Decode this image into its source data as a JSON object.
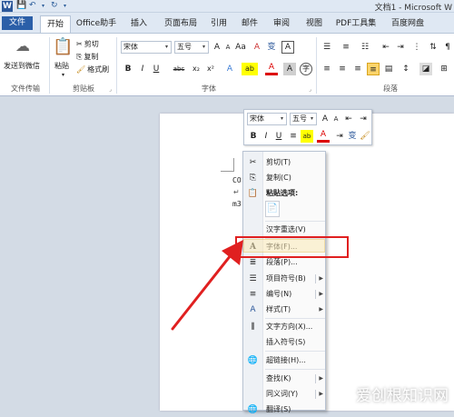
{
  "titlebar": {
    "app_icon": "W",
    "save_icon": "save-icon",
    "undo_icon": "undo-icon",
    "redo_icon": "redo-icon",
    "title": "文档1 - Microsoft W"
  },
  "tabs": [
    "文件",
    "开始",
    "Office助手",
    "插入",
    "页面布局",
    "引用",
    "邮件",
    "审阅",
    "视图",
    "PDF工具集",
    "百度网盘"
  ],
  "ribbon": {
    "wechat": {
      "label": "发送到微信",
      "group": "文件传输"
    },
    "clipboard": {
      "paste": "粘贴",
      "cut": "剪切",
      "copy": "复制",
      "format_painter": "格式刷",
      "group": "剪贴板"
    },
    "font": {
      "name": "宋体",
      "size": "五号",
      "group": "字体",
      "grow": "A",
      "shrink": "A",
      "aa": "Aa",
      "clear": "A",
      "wen": "变",
      "border_a": "A",
      "bold": "B",
      "italic": "I",
      "underline": "U",
      "strike": "abc",
      "sub": "x₂",
      "sup": "x²",
      "effect": "A",
      "highlight": "ab",
      "color": "A",
      "shade": "A",
      "circle": "字"
    },
    "paragraph": {
      "group": "段落"
    }
  },
  "document": {
    "line1": "CO",
    "line2": "↵",
    "line3": "m3"
  },
  "mini_toolbar": {
    "font": "宋体",
    "size": "五号",
    "grow": "A",
    "shrink": "A",
    "bold": "B",
    "italic": "I",
    "underline": "U",
    "color": "A",
    "wen": "变"
  },
  "context_menu": {
    "cut": "剪切(T)",
    "copy": "复制(C)",
    "paste_options": "粘贴选项:",
    "reconvert": "汉字重选(V)",
    "font": "字体(F)...",
    "paragraph": "段落(P)...",
    "bullets": "项目符号(B)",
    "numbering": "编号(N)",
    "styles": "样式(T)",
    "text_direction": "文字方向(X)...",
    "insert_symbol": "插入符号(S)",
    "hyperlink": "超链接(H)...",
    "find": "查找(K)",
    "synonyms": "同义词(Y)",
    "translate": "翻译(S)"
  },
  "watermark": "爱创根知识网",
  "colors": {
    "accent": "#2b579a",
    "highlight": "#fbeab8",
    "annotation": "#e02020"
  }
}
